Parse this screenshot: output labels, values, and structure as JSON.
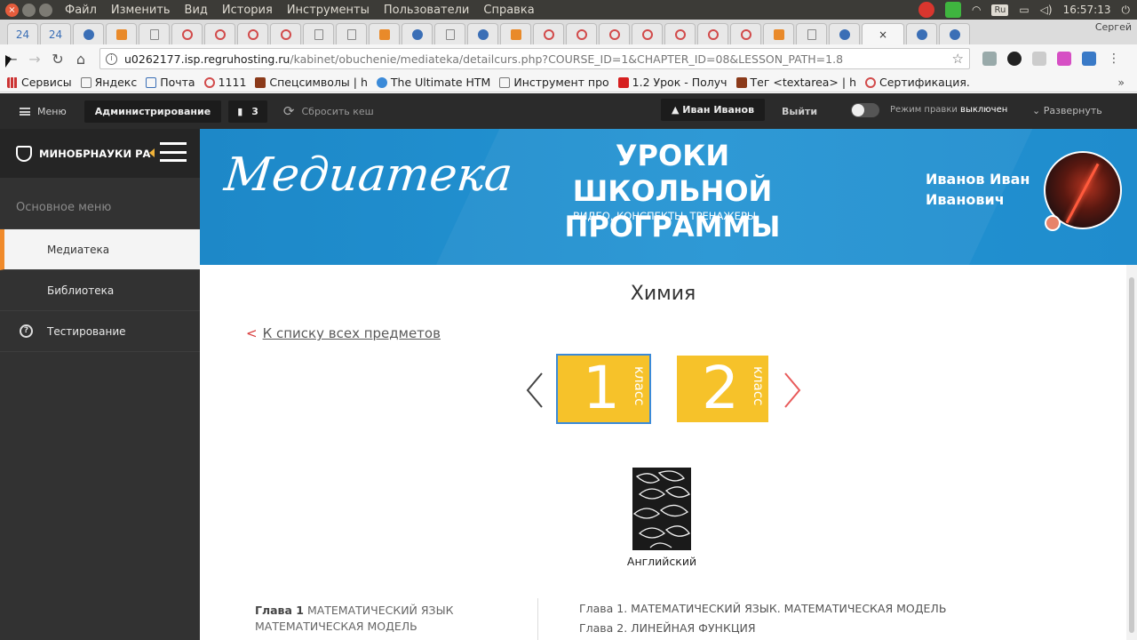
{
  "os": {
    "menu": [
      "Файл",
      "Изменить",
      "Вид",
      "История",
      "Инструменты",
      "Пользователи",
      "Справка"
    ],
    "lang": "Ru",
    "time": "16:57:13"
  },
  "tabs": {
    "items": [
      "24",
      "24"
    ],
    "profile": "Сергей"
  },
  "address": {
    "host": "u0262177.isp.regruhosting.ru",
    "path": "/kabinet/obuchenie/mediateka/detailcurs.php?COURSE_ID=1&CHAPTER_ID=08&LESSON_PATH=1.8"
  },
  "bookmarks": {
    "items": [
      "Сервисы",
      "Яндекс",
      "Почта",
      "1111",
      "Спецсимволы | h",
      "The Ultimate HTM",
      "Инструмент про",
      "1.2 Урок - Получ",
      "Тег <textarea> | h",
      "Сертификация."
    ],
    "more": "»"
  },
  "admin": {
    "menu": "Меню",
    "administration": "Администрирование",
    "count": "3",
    "clear_cache": "Сбросить кеш",
    "user": "Иван Иванов",
    "logout": "Выйти",
    "edit_mode_label": "Режим правки",
    "edit_mode_state": "выключен",
    "expand": "Развернуть"
  },
  "sidebar": {
    "org": "МИНОБРНАУКИ РА",
    "section": "Основное меню",
    "items": [
      {
        "label": "Медиатека"
      },
      {
        "label": "Библиотека"
      },
      {
        "label": "Тестирование"
      }
    ]
  },
  "banner": {
    "brand": "Медиатека",
    "title_line1": "УРОКИ",
    "title_line2": "ШКОЛЬНОЙ ПРОГРАММЫ",
    "subtitle": "ВИДЕО, КОНСПЕКТЫ, ТРЕНАЖЕРЫ",
    "user_line1": "Иванов Иван",
    "user_line2": "Иванович"
  },
  "content": {
    "subject": "Химия",
    "back_arrow": "<",
    "back_link": "К списку всех предметов",
    "grades": [
      {
        "number": "1",
        "word": "класс"
      },
      {
        "number": "2",
        "word": "класс"
      }
    ],
    "book_label": "Английский",
    "chapter_prefix": "Глава 1",
    "chapter_title": "МАТЕМАТИЧЕСКИЙ ЯЗЫК МАТЕМАТИЧЕСКАЯ МОДЕЛЬ",
    "chapters": [
      "Глава 1. МАТЕМАТИЧЕСКИЙ ЯЗЫК. МАТЕМАТИЧЕСКАЯ МОДЕЛЬ",
      "Глава 2. ЛИНЕЙНАЯ ФУНКЦИЯ"
    ]
  },
  "colors": {
    "banner_blue": "#2394d3",
    "grade_yellow": "#f6c22a",
    "accent_orange": "#f08a2a",
    "link_red": "#d93a3a"
  }
}
